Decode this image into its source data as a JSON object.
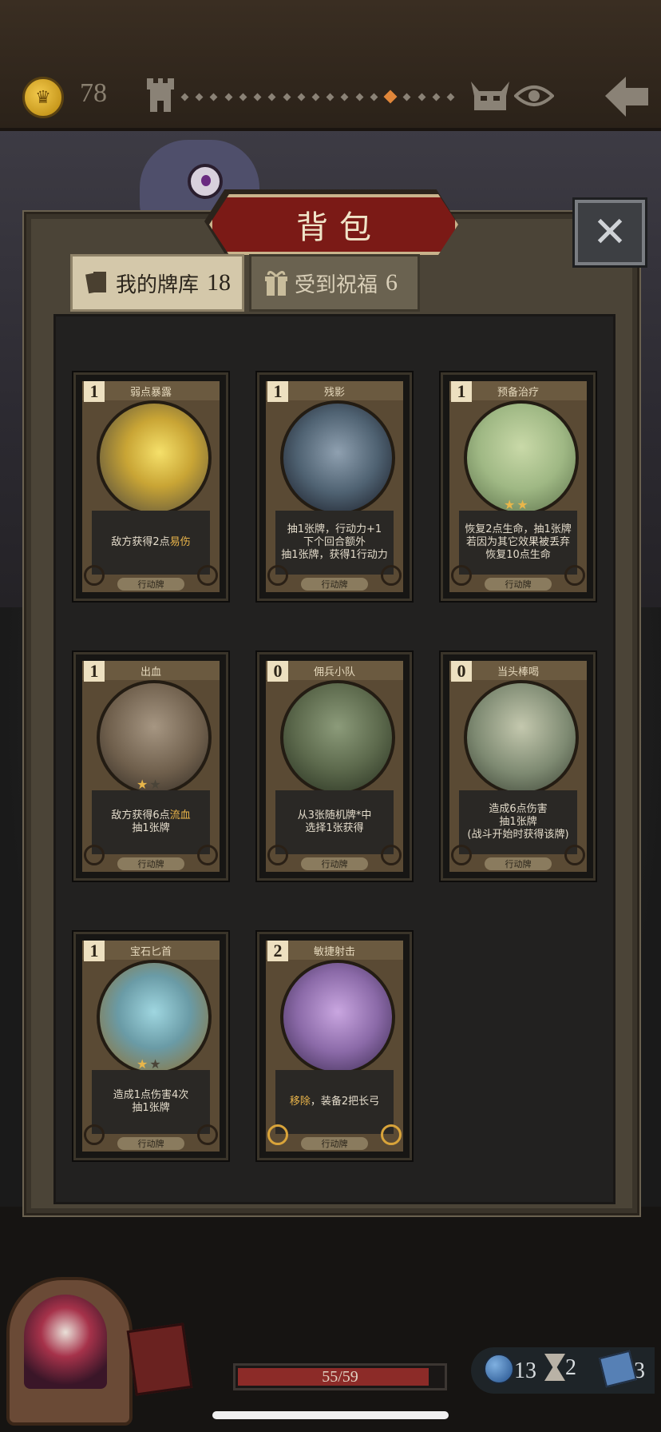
{
  "hud": {
    "gold": "78",
    "map_progress_total": 19,
    "map_progress_current": 14
  },
  "panel": {
    "title": "背包",
    "close_label": "✕"
  },
  "tabs": [
    {
      "label": "我的牌库",
      "count": "18",
      "active": true
    },
    {
      "label": "受到祝福",
      "count": "6",
      "active": false
    }
  ],
  "cards": [
    {
      "name": "弱点暴露",
      "cost": "1",
      "desc": [
        "敌方获得2点",
        {
          "hl": "易伤"
        }
      ],
      "type": "行动牌",
      "stars": 0,
      "art": "art-a"
    },
    {
      "name": "残影",
      "cost": "1",
      "desc_lines": [
        "抽1张牌，行动力+1",
        "下个回合额外",
        "抽1张牌，获得1行动力"
      ],
      "type": "行动牌",
      "stars": 0,
      "art": "art-b"
    },
    {
      "name": "预备治疗",
      "cost": "1",
      "desc_lines": [
        "恢复2点生命，抽1张牌",
        "若因为其它效果被丢弃",
        "恢复10点生命"
      ],
      "type": "行动牌",
      "stars": 2,
      "stars_total": 2,
      "art": "art-c"
    },
    {
      "name": "出血",
      "cost": "1",
      "desc_lines_rich": [
        [
          "敌方获得6点",
          {
            "hl": "流血"
          }
        ],
        [
          "抽1张牌"
        ]
      ],
      "type": "行动牌",
      "stars": 1,
      "stars_total": 2,
      "art": "art-d"
    },
    {
      "name": "佣兵小队",
      "cost": "0",
      "desc_lines": [
        "从3张随机牌*中",
        "选择1张获得"
      ],
      "type": "行动牌",
      "stars": 0,
      "art": "art-e"
    },
    {
      "name": "当头棒喝",
      "cost": "0",
      "desc_lines": [
        "造成6点伤害",
        "抽1张牌",
        "(战斗开始时获得该牌)"
      ],
      "type": "行动牌",
      "stars": 0,
      "art": "art-f"
    },
    {
      "name": "宝石匕首",
      "cost": "1",
      "desc_lines": [
        "造成1点伤害4次",
        "抽1张牌"
      ],
      "type": "行动牌",
      "stars": 1,
      "stars_total": 2,
      "art": "art-g"
    },
    {
      "name": "敏捷射击",
      "cost": "2",
      "desc_lines_rich": [
        [
          {
            "hl": "移除"
          },
          "，装备2把长弓"
        ]
      ],
      "type": "行动牌",
      "stars": 0,
      "art": "art-h",
      "gold": true
    }
  ],
  "bottom": {
    "hp": "55/59",
    "hp_fraction": 0.932,
    "orbs": "13",
    "hourglass": "2",
    "deck": "3"
  },
  "colors": {
    "highlight": "#e9b44a",
    "title_plaque": "#7b1a16",
    "hp_fill": "#8c2b28"
  }
}
